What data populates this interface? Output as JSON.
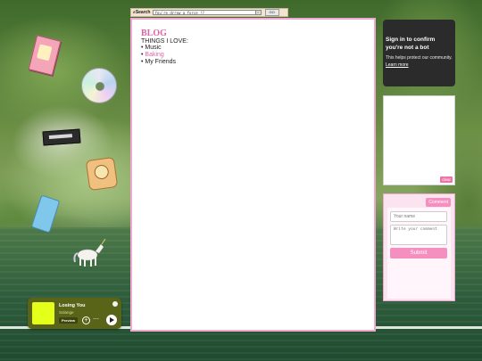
{
  "search": {
    "label": "Search",
    "value": "You're drrew a force !?",
    "go_label": "GO"
  },
  "blog": {
    "title": "BLOG",
    "subtitle": "THINGS I LOVE:",
    "items": [
      {
        "label": "Music"
      },
      {
        "label": "Baking"
      },
      {
        "label": "My Friends"
      }
    ]
  },
  "bot_check": {
    "heading": "Sign in to confirm you're not a bot",
    "text": "This helps protect our community.",
    "link": "Learn more"
  },
  "draw": {
    "clear_label": "clear"
  },
  "comments": {
    "comment_label": "Comment",
    "name_placeholder": "Your name",
    "comment_placeholder": "Write your comment",
    "submit_label": "Submit"
  },
  "player": {
    "track": "Losing You",
    "artist": "Solange",
    "preview_label": "Preview",
    "more_icon": "⋯"
  },
  "colors": {
    "accent_pink": "#e062a8",
    "button_pink": "#f58fc0",
    "player_bg": "#5a6418",
    "album_art": "#e4ff1a"
  }
}
